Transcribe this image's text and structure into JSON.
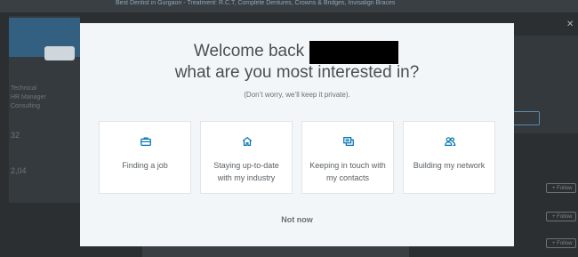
{
  "background": {
    "ad_text": "Best Dentist in Gurgaon - Treatment: R.C.T, Complete Dentures, Crowns & Bridges, Invisalign Braces",
    "left_lines": [
      "Technical",
      "HR Manager",
      "Consulting"
    ],
    "left_stats": [
      "32",
      "2,04"
    ],
    "follow_label": "+ Follow"
  },
  "modal": {
    "title_line1": "Welcome back",
    "title_line2": "what are you most interested in?",
    "subtitle": "(Don’t worry, we’ll keep it private).",
    "cards": [
      {
        "label": "Finding a job",
        "icon": "briefcase-icon"
      },
      {
        "label": "Staying up-to-date with my industry",
        "icon": "home-icon"
      },
      {
        "label": "Keeping in touch with my contacts",
        "icon": "messages-icon"
      },
      {
        "label": "Building my network",
        "icon": "people-icon"
      }
    ],
    "not_now": "Not now",
    "accent_color": "#0073b1"
  }
}
